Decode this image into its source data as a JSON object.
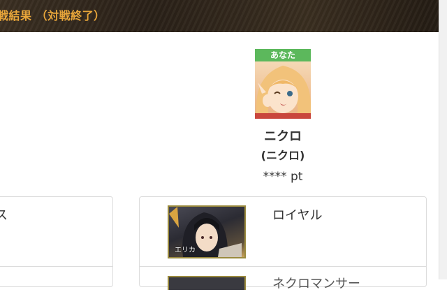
{
  "header": {
    "title": "戦結果 （対戦終了）"
  },
  "player": {
    "badge": "あなた",
    "name": "ニクロ",
    "subname": "(ニクロ)",
    "points": "**** pt"
  },
  "left_panel": {
    "class_text": "ス"
  },
  "right_panel": {
    "class_text": "ロイヤル",
    "card_label": "エリカ",
    "next_row_text": "ネクロマンサー"
  }
}
